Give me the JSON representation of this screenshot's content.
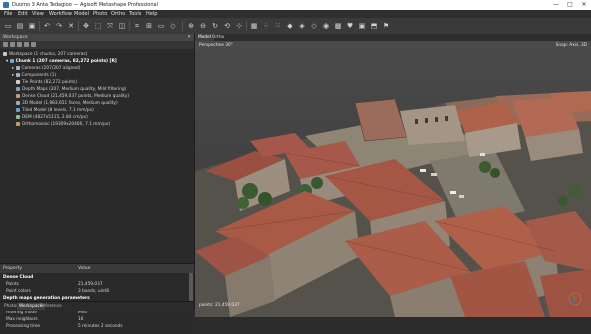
{
  "window": {
    "title": "Duomo 3 Anta Tedagioo — Agisoft Metashape Professional",
    "controls": [
      "—",
      "□",
      "✕"
    ]
  },
  "menu": [
    "File",
    "Edit",
    "View",
    "Workflow",
    "Model",
    "Photo",
    "Ortho",
    "Tools",
    "Help"
  ],
  "workspace": {
    "panel_title": "Workspace",
    "close": "✕",
    "tree": [
      {
        "label": "Workspace (1 chunks, 207 cameras)",
        "level": 0,
        "icon": "workspace-icon"
      },
      {
        "label": "Chunk 1 (207 cameras, 82,272 points) [R]",
        "level": 1,
        "bold": true,
        "icon": "chunk-icon"
      },
      {
        "label": "Cameras (207/207 aligned)",
        "level": 2,
        "icon": "cameras-icon"
      },
      {
        "label": "Components (1)",
        "level": 2,
        "icon": "components-icon"
      },
      {
        "label": "Tie Points (82,272 points)",
        "level": 3,
        "icon": "tie-points-icon"
      },
      {
        "label": "Depth Maps (207, Medium quality, Mild filtering)",
        "level": 3,
        "icon": "depth-maps-icon"
      },
      {
        "label": "Dense Cloud (21,459,037 points, Medium quality)",
        "level": 3,
        "icon": "dense-cloud-icon"
      },
      {
        "label": "3D Model (1,983,651 faces, Medium quality)",
        "level": 3,
        "icon": "model-icon"
      },
      {
        "label": "Tiled Model (8 levels, 7.1 mm/px)",
        "level": 3,
        "icon": "tiled-model-icon"
      },
      {
        "label": "DEM (4827x5115, 2.84 cm/px)",
        "level": 3,
        "icon": "dem-icon"
      },
      {
        "label": "Orthomosaic (19309x20460, 7.1 mm/px)",
        "level": 3,
        "icon": "orthomosaic-icon"
      }
    ]
  },
  "properties": {
    "col_property": "Property",
    "col_value": "Value",
    "rows": [
      {
        "k": "Dense Cloud",
        "v": "",
        "group": true
      },
      {
        "k": "Points",
        "v": "21,459,037"
      },
      {
        "k": "Point colors",
        "v": "3 bands, uint8"
      },
      {
        "k": "Depth maps generation parameters",
        "v": "",
        "group": true
      },
      {
        "k": "Quality",
        "v": "Medium"
      },
      {
        "k": "Filtering mode",
        "v": "Mild"
      },
      {
        "k": "Max neighbors",
        "v": "16"
      },
      {
        "k": "Processing time",
        "v": "5 minutes 2 seconds"
      }
    ]
  },
  "bottom_tabs": [
    "Photos",
    "Workspace",
    "Reference"
  ],
  "view_tabs": [
    "Model",
    "Ortho"
  ],
  "viewport": {
    "projection_label": "Perspective 30°",
    "snap_label": "Snap: Axis, 3D",
    "points_label": "points: 21,459,037"
  },
  "colors": {
    "accent": "#2f4c6e",
    "roof": "#9a5040",
    "wall": "#a59585"
  }
}
